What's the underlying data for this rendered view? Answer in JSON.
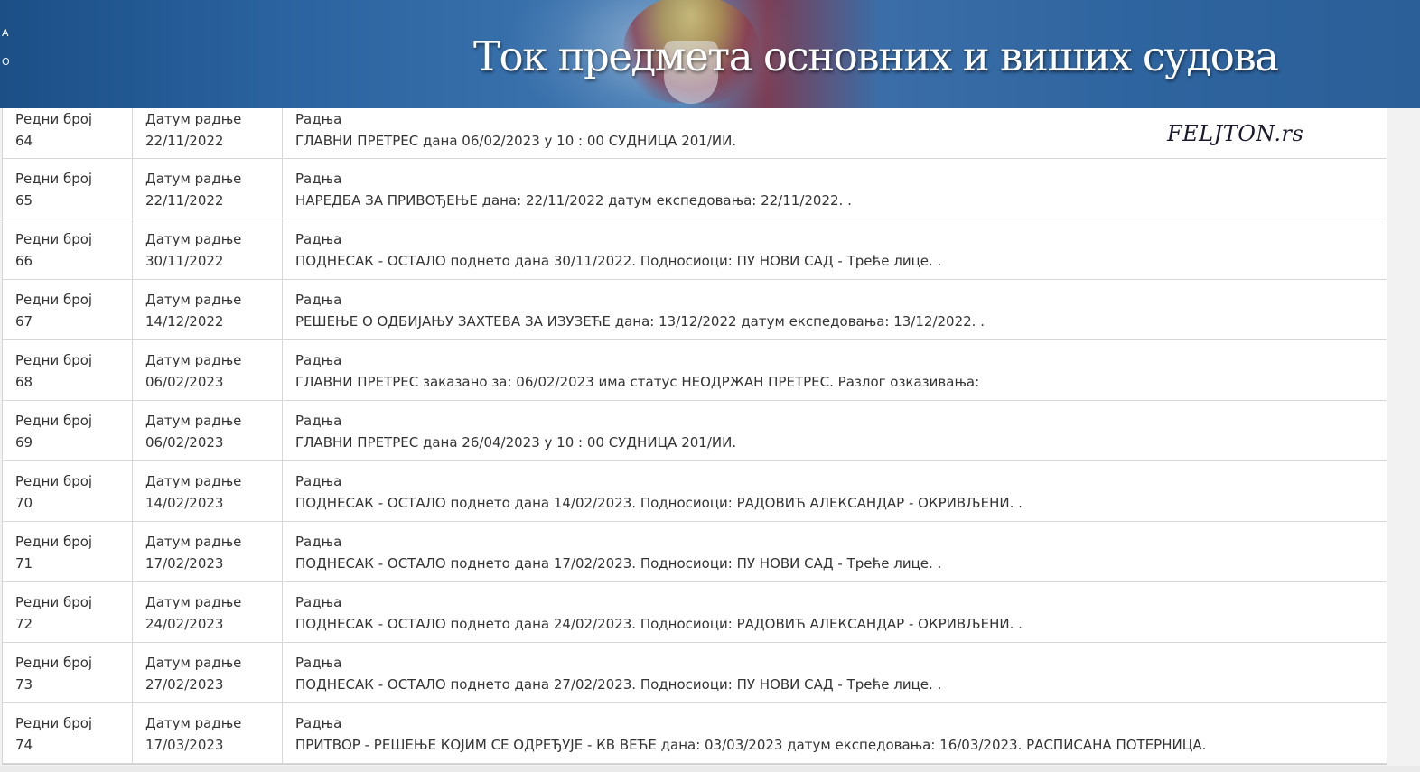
{
  "header": {
    "title": "Ток предмета основних и виших судова",
    "side_letters": [
      "А",
      "О"
    ]
  },
  "watermark": "FELJTON.rs",
  "columns": {
    "number_label": "Редни број",
    "date_label": "Датум радње",
    "action_label": "Радња"
  },
  "rows": [
    {
      "number": "64",
      "date": "22/11/2022",
      "action": "ГЛАВНИ ПРЕТРЕС дана 06/02/2023 у 10 : 00 СУДНИЦА 201/ИИ."
    },
    {
      "number": "65",
      "date": "22/11/2022",
      "action": "НАРЕДБА ЗА ПРИВОЂЕЊЕ дана: 22/11/2022 датум експедовања: 22/11/2022. ."
    },
    {
      "number": "66",
      "date": "30/11/2022",
      "action": "ПОДНЕСАК - ОСТАЛО поднето дана 30/11/2022. Подносиоци: ПУ НОВИ САД - Треће лице. ."
    },
    {
      "number": "67",
      "date": "14/12/2022",
      "action": "РЕШЕЊЕ О ОДБИЈАЊУ ЗАХТЕВА ЗА ИЗУЗЕЋЕ дана: 13/12/2022 датум експедовања: 13/12/2022. ."
    },
    {
      "number": "68",
      "date": "06/02/2023",
      "action": "ГЛАВНИ ПРЕТРЕС заказано за: 06/02/2023 има статус НЕОДРЖАН ПРЕТРЕС. Разлог озказивања:"
    },
    {
      "number": "69",
      "date": "06/02/2023",
      "action": "ГЛАВНИ ПРЕТРЕС дана 26/04/2023 у 10 : 00 СУДНИЦА 201/ИИ."
    },
    {
      "number": "70",
      "date": "14/02/2023",
      "action": "ПОДНЕСАК - ОСТАЛО поднето дана 14/02/2023. Подносиоци: РАДОВИЋ АЛЕКСАНДАР - ОКРИВЉЕНИ. ."
    },
    {
      "number": "71",
      "date": "17/02/2023",
      "action": "ПОДНЕСАК - ОСТАЛО поднето дана 17/02/2023. Подносиоци: ПУ НОВИ САД - Треће лице. ."
    },
    {
      "number": "72",
      "date": "24/02/2023",
      "action": "ПОДНЕСАК - ОСТАЛО поднето дана 24/02/2023. Подносиоци: РАДОВИЋ АЛЕКСАНДАР - ОКРИВЉЕНИ. ."
    },
    {
      "number": "73",
      "date": "27/02/2023",
      "action": "ПОДНЕСАК - ОСТАЛО поднето дана 27/02/2023. Подносиоци: ПУ НОВИ САД - Треће лице. ."
    },
    {
      "number": "74",
      "date": "17/03/2023",
      "action": "ПРИТВОР - РЕШЕЊЕ КОЈИМ СЕ ОДРЕЂУЈЕ - КВ ВЕЋЕ дана: 03/03/2023 датум експедовања: 16/03/2023. РАСПИСАНА ПОТЕРНИЦА."
    }
  ]
}
